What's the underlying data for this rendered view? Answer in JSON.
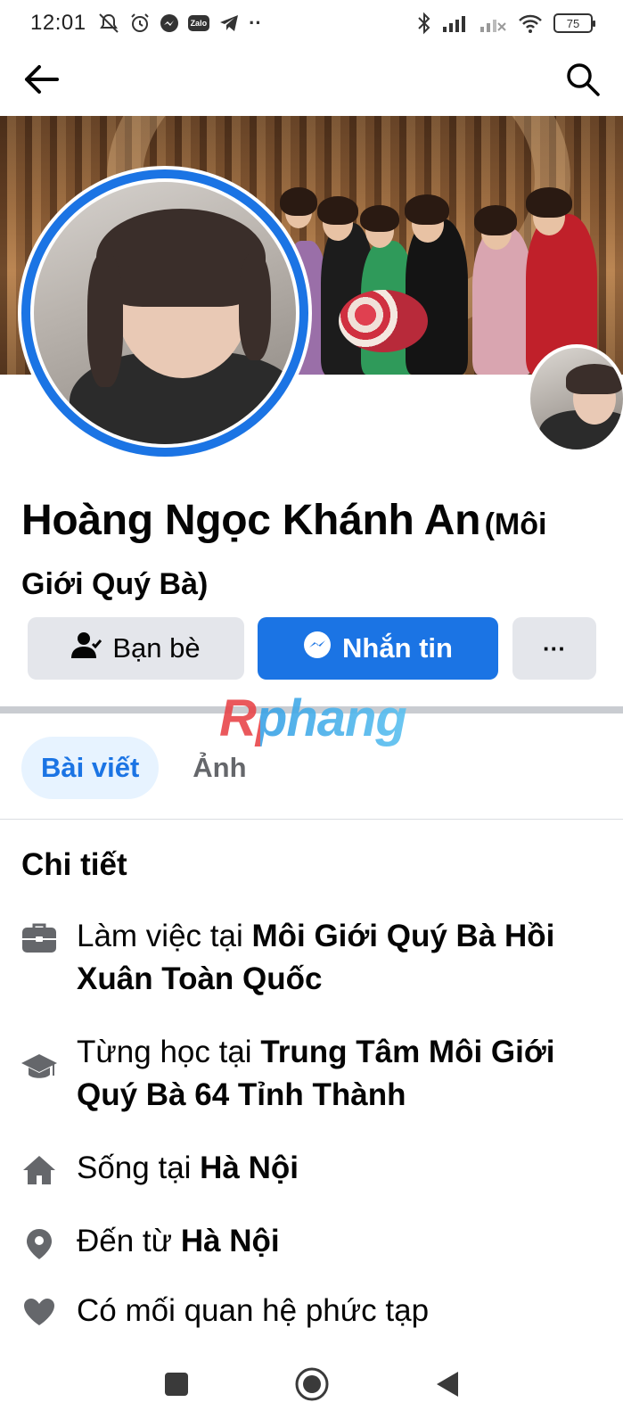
{
  "status_bar": {
    "time": "12:01",
    "zalo_label": "Zalo",
    "battery": "75",
    "more_dots": "··"
  },
  "profile": {
    "name": "Hoàng Ngọc Khánh An",
    "alt_name": "(Môi Giới Quý Bà)"
  },
  "actions": {
    "friends_label": "Bạn bè",
    "message_label": "Nhắn tin",
    "more_label": "···"
  },
  "watermark": "Rphang",
  "tabs": [
    {
      "label": "Bài viết",
      "active": true
    },
    {
      "label": "Ảnh",
      "active": false
    }
  ],
  "details": {
    "title": "Chi tiết",
    "work_prefix": "Làm việc tại ",
    "work_place": "Môi Giới Quý Bà Hồi Xuân Toàn Quốc",
    "study_prefix": "Từng học tại ",
    "study_place": "Trung Tâm Môi Giới Quý Bà 64 Tỉnh Thành",
    "lives_prefix": "Sống tại ",
    "lives_place": "Hà Nội",
    "from_prefix": "Đến từ ",
    "from_place": "Hà Nội",
    "relationship": "Có mối quan hệ phức tạp"
  },
  "colors": {
    "accent": "#1b74e4",
    "button_gray": "#e4e6eb",
    "tab_active_bg": "#e7f3ff",
    "icon_gray": "#65676b"
  },
  "icons": [
    "back-arrow-icon",
    "search-icon",
    "add-friend-icon",
    "messenger-icon",
    "briefcase-icon",
    "graduation-cap-icon",
    "home-icon",
    "location-pin-icon",
    "heart-icon"
  ]
}
